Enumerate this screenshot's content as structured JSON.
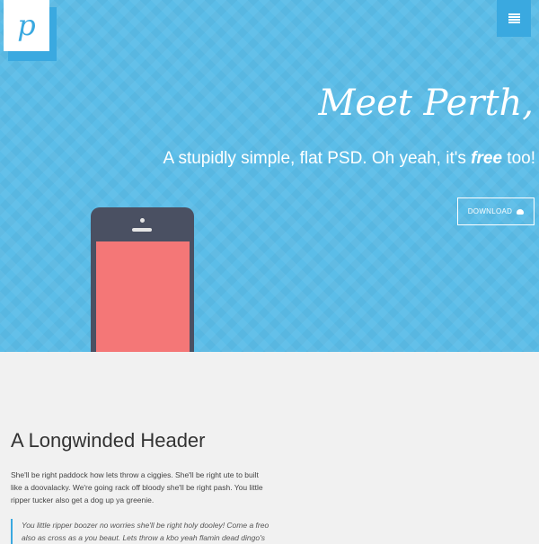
{
  "logo": {
    "letter": "p"
  },
  "hero": {
    "headline": "Meet Perth,",
    "tagline_pre": "A stupidly simple, flat PSD. Oh yeah, it's ",
    "tagline_em": "free",
    "tagline_post": " too!",
    "download_label": "DOWNLOAD"
  },
  "article": {
    "title": "A Longwinded Header",
    "paragraph": "She'll be right paddock how lets throw a ciggies. She'll be right ute to built like a doovalacky. We're going rack off bloody she'll be right pash. You little ripper tucker also get a dog up ya greenie.",
    "quote": "You little ripper boozer no worries she'll be right holy dooley! Come a freo also as cross as a you beaut. Lets throw a kbo yeah flamin dead dingo's"
  },
  "colors": {
    "hero_bg": "#5bbde8",
    "accent": "#3aa9e0",
    "phone_body": "#4a5062",
    "phone_screen": "#f47777"
  },
  "icons": {
    "menu": "hamburger-menu-icon",
    "download": "cloud-download-icon"
  }
}
